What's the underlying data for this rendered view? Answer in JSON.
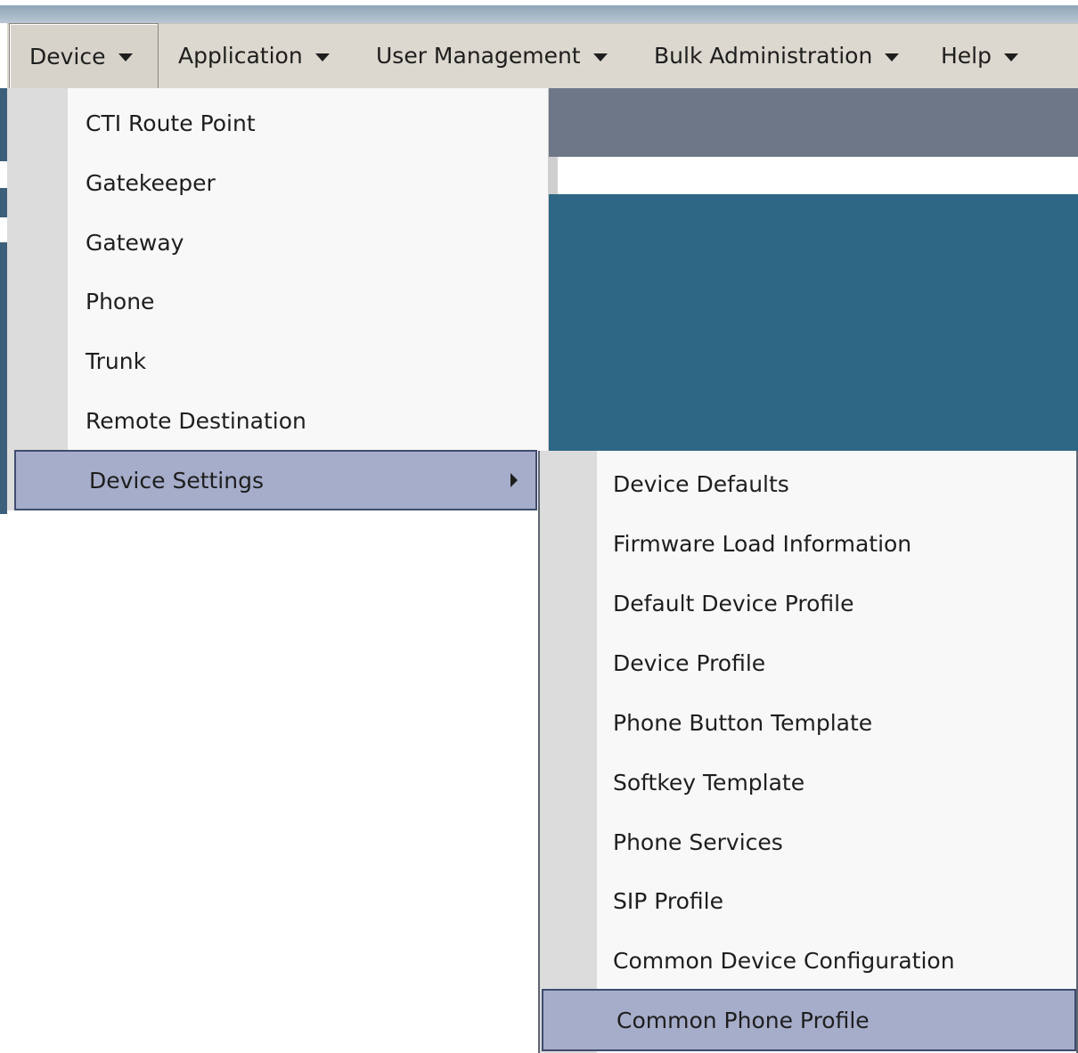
{
  "menubar": {
    "items": [
      {
        "label": "Device",
        "active": true
      },
      {
        "label": "Application"
      },
      {
        "label": "User Management"
      },
      {
        "label": "Bulk Administration"
      },
      {
        "label": "Help"
      }
    ]
  },
  "device_menu": {
    "items": [
      {
        "label": "CTI Route Point"
      },
      {
        "label": "Gatekeeper"
      },
      {
        "label": "Gateway"
      },
      {
        "label": "Phone"
      },
      {
        "label": "Trunk"
      },
      {
        "label": "Remote Destination"
      },
      {
        "label": "Device Settings",
        "has_submenu": true,
        "highlighted": true
      }
    ]
  },
  "device_settings_submenu": {
    "items": [
      {
        "label": "Device Defaults"
      },
      {
        "label": "Firmware Load Information"
      },
      {
        "label": "Default Device Profile"
      },
      {
        "label": "Device Profile"
      },
      {
        "label": "Phone Button Template"
      },
      {
        "label": "Softkey Template"
      },
      {
        "label": "Phone Services"
      },
      {
        "label": "SIP Profile"
      },
      {
        "label": "Common Device Configuration"
      },
      {
        "label": "Common Phone Profile",
        "highlighted": true
      }
    ]
  },
  "colors": {
    "menubar_bg": "#dcd8cf",
    "menu_bg": "#f8f8f8",
    "menu_gutter": "#dcdcdc",
    "highlight_bg": "#a6adca",
    "highlight_border": "#3e4c6e",
    "page_teal": "#2e6785",
    "page_dark_band": "#6e7788"
  },
  "icons": {
    "menu_caret": "caret-down-icon",
    "submenu_arrow": "chevron-right-icon"
  }
}
